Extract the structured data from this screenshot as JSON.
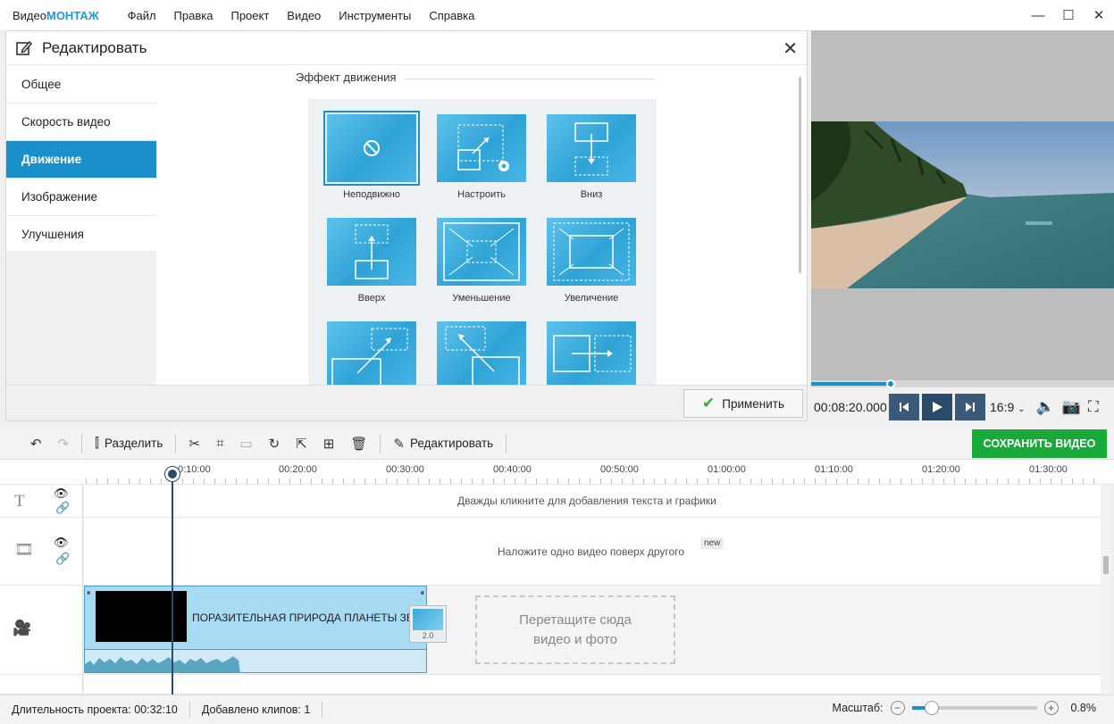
{
  "app": {
    "logo_part1": "Видео",
    "logo_part2": "МОНТАЖ"
  },
  "menu": [
    "Файл",
    "Правка",
    "Проект",
    "Видео",
    "Инструменты",
    "Справка"
  ],
  "window_controls": {
    "minimize": "—",
    "maximize": "☐",
    "close": "✕"
  },
  "edit_panel": {
    "title": "Редактировать",
    "tabs": [
      "Общее",
      "Скорость видео",
      "Движение",
      "Изображение",
      "Улучшения"
    ],
    "active_tab": "Движение",
    "section_title": "Эффект движения",
    "tiles": [
      "Неподвижно",
      "Настроить",
      "Вниз",
      "Вверх",
      "Уменьшение",
      "Увеличение",
      "",
      "",
      ""
    ],
    "selected_tile": "Неподвижно",
    "apply_label": "Применить"
  },
  "player": {
    "timecode": "00:08:20.000",
    "aspect": "16:9",
    "progress_fraction": 0.26
  },
  "toolbar": {
    "split_label": "Разделить",
    "edit_label": "Редактировать",
    "save_label": "СОХРАНИТЬ ВИДЕО"
  },
  "timeline": {
    "ruler": [
      "0:10:00",
      "00:20:00",
      "00:30:00",
      "00:40:00",
      "00:50:00",
      "01:00:00",
      "01:10:00",
      "01:20:00",
      "01:30:00"
    ],
    "text_hint": "Дважды кликните для добавления текста и графики",
    "overlay_hint": "Наложите одно видео поверх другого",
    "new_badge": "new",
    "clip_title": "ПОРАЗИТЕЛЬНАЯ ПРИРОДА ПЛАНЕТЫ ЗЕ",
    "transition_value": "2.0",
    "drop_line1": "Перетащите сюда",
    "drop_line2": "видео и фото"
  },
  "status": {
    "duration": "Длительность проекта:  00:32:10",
    "clips": "Добавлено клипов: 1",
    "scale_label": "Масштаб:",
    "scale_value": "0.8%"
  },
  "colors": {
    "accent": "#1a8fc9",
    "save": "#19a93b",
    "playhead": "#2d4a66"
  }
}
